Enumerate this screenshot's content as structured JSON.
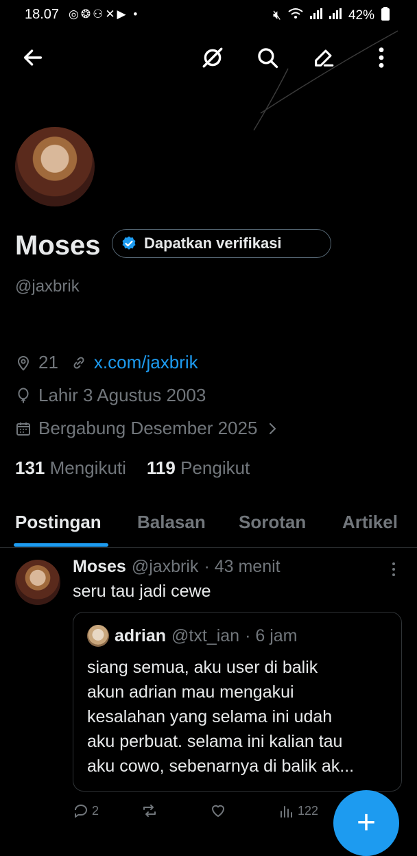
{
  "status": {
    "time": "18.07",
    "app_icons": "◎❂⚇✕▶ •",
    "battery": "42%"
  },
  "colors": {
    "accent": "#1d9bf0",
    "bg": "#000000",
    "muted": "#71767b"
  },
  "profile": {
    "name": "Moses",
    "verify_label": "Dapatkan verifikasi",
    "handle": "@jaxbrik",
    "location": "21",
    "website": "x.com/jaxbrik",
    "birthday": "Lahir 3 Agustus 2003",
    "joined": "Bergabung Desember 2025",
    "following_count": "131",
    "following_label": "Mengikuti",
    "followers_count": "119",
    "followers_label": "Pengikut"
  },
  "tabs": [
    {
      "label": "Postingan",
      "active": true
    },
    {
      "label": "Balasan"
    },
    {
      "label": "Sorotan"
    },
    {
      "label": "Artikel"
    }
  ],
  "post": {
    "name": "Moses",
    "handle": "@jaxbrik",
    "time": "· 43 menit",
    "text": "seru tau jadi cewe",
    "quote": {
      "name": "adrian",
      "handle": "@txt_ian",
      "time": "· 6 jam",
      "lines": [
        "siang semua, aku user di balik",
        "akun adrian mau mengakui",
        "kesalahan yang selama ini udah",
        "aku perbuat. selama ini kalian tau",
        "aku cowo, sebenarnya di balik ak..."
      ]
    },
    "replies": "2",
    "views": "122"
  },
  "fab_label": "+"
}
